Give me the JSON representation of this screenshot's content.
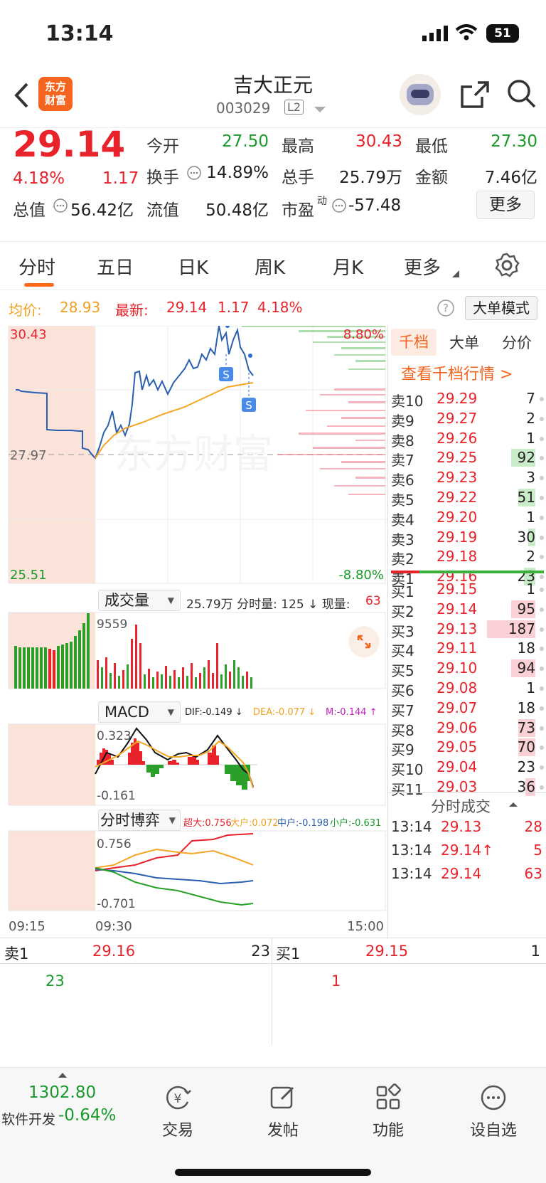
{
  "status": {
    "time": "13:14",
    "battery": "51"
  },
  "header": {
    "name": "吉大正元",
    "code": "003029",
    "level": "L2",
    "logo_line1": "东方",
    "logo_line2": "财富"
  },
  "quote": {
    "price": "29.14",
    "pct": "4.18%",
    "chg": "1.17",
    "open_label": "今开",
    "open": "27.50",
    "high_label": "最高",
    "high": "30.43",
    "low_label": "最低",
    "low": "27.30",
    "turnover_label": "换手",
    "turnover": "14.89%",
    "vol_label": "总手",
    "vol": "25.79万",
    "amount_label": "金额",
    "amount": "7.46亿",
    "mktcap_label": "总值",
    "mktcap": "56.42亿",
    "float_label": "流值",
    "float": "50.48亿",
    "pe_label": "市盈",
    "pe_sup": "动",
    "pe": "-57.48",
    "more": "更多"
  },
  "tabs": [
    "分时",
    "五日",
    "日K",
    "周K",
    "月K",
    "更多"
  ],
  "infobar": {
    "avg_label": "均价:",
    "avg": "28.93",
    "last_label": "最新:",
    "last": "29.14",
    "chg": "1.17",
    "pct": "4.18%",
    "mode": "大单模式"
  },
  "chart": {
    "ymax": "30.43",
    "ymid": "27.97",
    "ymin": "25.51",
    "pmax": "8.80%",
    "pmin": "-8.80%",
    "vol_title": "成交量",
    "vol_info": "25.79万 分时量: 125 ↓ 现量:",
    "vol_now": "63",
    "vol_max": "9559",
    "macd_title": "MACD",
    "dif": "DIF:-0.149 ↓",
    "dea": "DEA:-0.077 ↓",
    "m": "M:-0.144 ↑",
    "macd_max": "0.323",
    "macd_min": "-0.161",
    "game_title": "分时博弈",
    "g_super": "超大:0.756",
    "g_big": "大户:0.072",
    "g_mid": "中户:-0.198",
    "g_small": "小户:-0.631",
    "game_max": "0.756",
    "game_min": "-0.701",
    "t0": "09:15",
    "t1": "09:30",
    "t2": "15:00",
    "s_label": "S",
    "watermark": "东方财富"
  },
  "orderbook": {
    "tabs": [
      "千档",
      "大单",
      "分价"
    ],
    "link": "查看千档行情 >",
    "asks": [
      {
        "l": "卖10",
        "p": "29.29",
        "v": "7"
      },
      {
        "l": "卖9",
        "p": "29.27",
        "v": "2"
      },
      {
        "l": "卖8",
        "p": "29.26",
        "v": "1"
      },
      {
        "l": "卖7",
        "p": "29.25",
        "v": "92"
      },
      {
        "l": "卖6",
        "p": "29.23",
        "v": "3"
      },
      {
        "l": "卖5",
        "p": "29.22",
        "v": "51"
      },
      {
        "l": "卖4",
        "p": "29.20",
        "v": "1"
      },
      {
        "l": "卖3",
        "p": "29.19",
        "v": "30"
      },
      {
        "l": "卖2",
        "p": "29.18",
        "v": "2"
      },
      {
        "l": "卖1",
        "p": "29.16",
        "v": "23"
      }
    ],
    "bids": [
      {
        "l": "买1",
        "p": "29.15",
        "v": "1"
      },
      {
        "l": "买2",
        "p": "29.14",
        "v": "95"
      },
      {
        "l": "买3",
        "p": "29.13",
        "v": "187"
      },
      {
        "l": "买4",
        "p": "29.11",
        "v": "18"
      },
      {
        "l": "买5",
        "p": "29.10",
        "v": "94"
      },
      {
        "l": "买6",
        "p": "29.08",
        "v": "1"
      },
      {
        "l": "买7",
        "p": "29.07",
        "v": "18"
      },
      {
        "l": "买8",
        "p": "29.06",
        "v": "73"
      },
      {
        "l": "买9",
        "p": "29.05",
        "v": "70"
      },
      {
        "l": "买10",
        "p": "29.04",
        "v": "23"
      },
      {
        "l": "买11",
        "p": "29.03",
        "v": "36"
      }
    ],
    "trades_title": "分时成交",
    "trades": [
      {
        "t": "13:14",
        "p": "29.13",
        "v": "28"
      },
      {
        "t": "13:14",
        "p": "29.14↑",
        "v": "5"
      },
      {
        "t": "13:14",
        "p": "29.14",
        "v": "63"
      }
    ]
  },
  "bottom": {
    "ask_label": "卖1",
    "ask_p": "29.16",
    "ask_v": "23",
    "ask_q": "23",
    "bid_label": "买1",
    "bid_p": "29.15",
    "bid_v": "1",
    "bid_q": "1"
  },
  "tabbar": {
    "index_val": "1302.80",
    "index_name": "软件开发",
    "index_pct": "-0.64%",
    "trade": "交易",
    "post": "发帖",
    "func": "功能",
    "watch": "设自选"
  }
}
